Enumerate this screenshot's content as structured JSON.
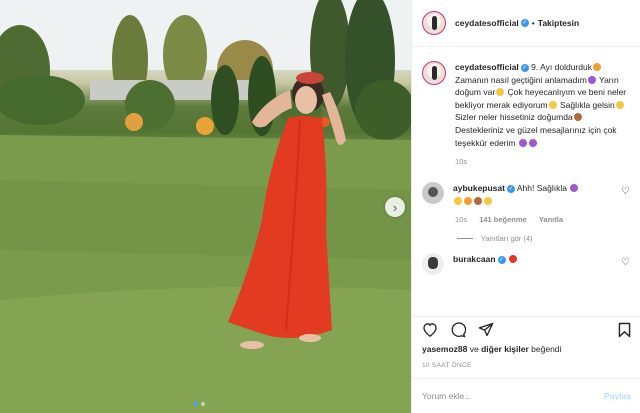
{
  "post": {
    "author": "ceydatesofficial",
    "follow_status": "Takiptesin",
    "separator": "•",
    "caption": {
      "p1": "9. Ayı doldurduk",
      "p2": " Zamanın nasıl geçtiğini anlamadım",
      "p3": " Yarın doğum var",
      "p4": " Çok heyecanlıyım ve beni neler bekliyor merak ediyorum",
      "p5": " Sağlıkla gelsin",
      "p6": " Sizler neler hissetiniz doğumda",
      "p7": " Destekleriniz ve güzel mesajlarınız için çok teşekkür ederim"
    },
    "caption_time": "10s",
    "liked_by_prefix": "yasemoz88",
    "liked_by_mid": " ve ",
    "liked_by_rest": "diğer kişiler",
    "liked_by_suffix": " beğendi",
    "posted_ago": "10 SAAT ÖNCE",
    "comment_placeholder": "Yorum ekle...",
    "post_label": "Paylaş"
  },
  "comments": [
    {
      "user": "aybukepusat",
      "text": " Ahh! Sağlıkla ",
      "time": "10s",
      "likes": "141 beğenme",
      "reply_label": "Yanıtla",
      "view_replies": "Yanıtları gör (4)"
    },
    {
      "user": "burakcaan",
      "text": " "
    }
  ],
  "icons": {
    "verified": "verified-badge-icon",
    "next": "chevron-right-icon",
    "heart": "heart-icon",
    "comment": "comment-icon",
    "share": "paper-plane-icon",
    "bookmark": "bookmark-icon"
  },
  "colors": {
    "dress": "#e23b22",
    "verified": "#3897f0",
    "post_button": "#b2dffc",
    "ring": "#d62976"
  }
}
